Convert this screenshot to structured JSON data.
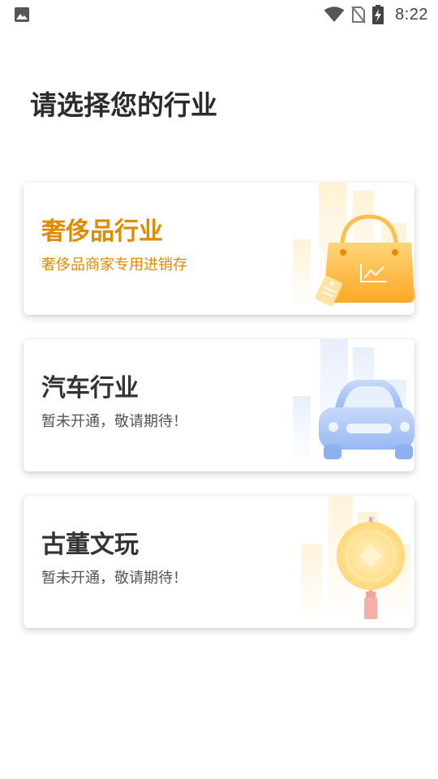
{
  "status_bar": {
    "time": "8:22",
    "left_icon": "image-icon",
    "icons": [
      "wifi-icon",
      "no-sim-icon",
      "battery-charging-icon"
    ]
  },
  "page": {
    "title": "请选择您的行业"
  },
  "industries": [
    {
      "title": "奢侈品行业",
      "subtitle": "奢侈品商家专用进销存",
      "icon": "shopping-bag-icon",
      "accent": "#e08a00"
    },
    {
      "title": "汽车行业",
      "subtitle": "暂未开通，敬请期待！",
      "icon": "car-icon",
      "accent": "#9bbcf5"
    },
    {
      "title": "古董文玩",
      "subtitle": "暂未开通，敬请期待！",
      "icon": "antique-coin-icon",
      "accent": "#f5c65a"
    }
  ]
}
